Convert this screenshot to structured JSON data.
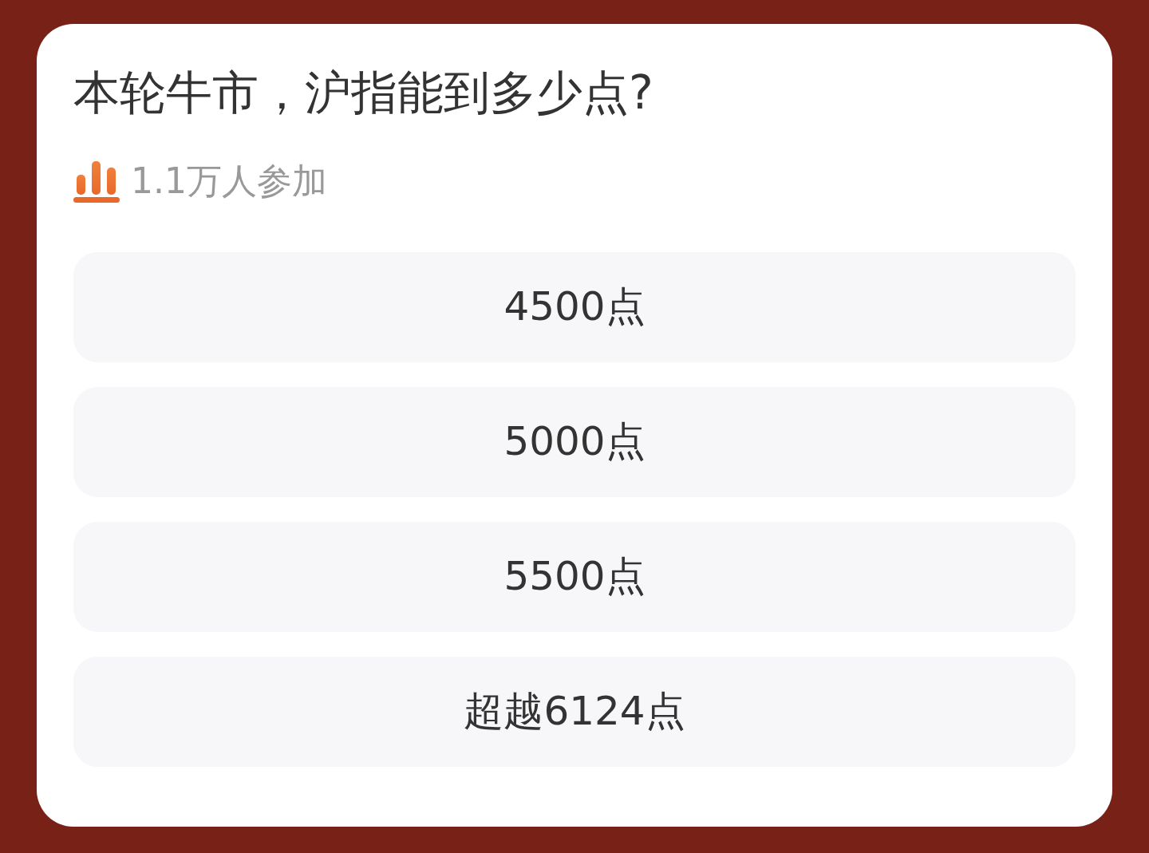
{
  "question": "本轮牛市，沪指能到多少点?",
  "participants": "1.1万人参加",
  "options": [
    {
      "label": "4500点",
      "selected": false
    },
    {
      "label": "5000点",
      "selected": false
    },
    {
      "label": "5500点",
      "selected": false
    },
    {
      "label": "超越6124点",
      "selected": false
    }
  ]
}
